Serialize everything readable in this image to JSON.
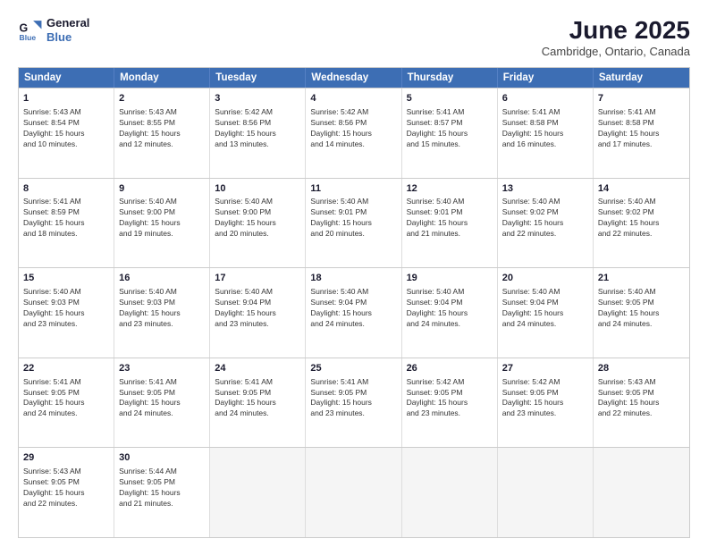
{
  "logo": {
    "line1": "General",
    "line2": "Blue"
  },
  "title": "June 2025",
  "location": "Cambridge, Ontario, Canada",
  "header_days": [
    "Sunday",
    "Monday",
    "Tuesday",
    "Wednesday",
    "Thursday",
    "Friday",
    "Saturday"
  ],
  "rows": [
    [
      {
        "day": "1",
        "lines": [
          "Sunrise: 5:43 AM",
          "Sunset: 8:54 PM",
          "Daylight: 15 hours",
          "and 10 minutes."
        ]
      },
      {
        "day": "2",
        "lines": [
          "Sunrise: 5:43 AM",
          "Sunset: 8:55 PM",
          "Daylight: 15 hours",
          "and 12 minutes."
        ]
      },
      {
        "day": "3",
        "lines": [
          "Sunrise: 5:42 AM",
          "Sunset: 8:56 PM",
          "Daylight: 15 hours",
          "and 13 minutes."
        ]
      },
      {
        "day": "4",
        "lines": [
          "Sunrise: 5:42 AM",
          "Sunset: 8:56 PM",
          "Daylight: 15 hours",
          "and 14 minutes."
        ]
      },
      {
        "day": "5",
        "lines": [
          "Sunrise: 5:41 AM",
          "Sunset: 8:57 PM",
          "Daylight: 15 hours",
          "and 15 minutes."
        ]
      },
      {
        "day": "6",
        "lines": [
          "Sunrise: 5:41 AM",
          "Sunset: 8:58 PM",
          "Daylight: 15 hours",
          "and 16 minutes."
        ]
      },
      {
        "day": "7",
        "lines": [
          "Sunrise: 5:41 AM",
          "Sunset: 8:58 PM",
          "Daylight: 15 hours",
          "and 17 minutes."
        ]
      }
    ],
    [
      {
        "day": "8",
        "lines": [
          "Sunrise: 5:41 AM",
          "Sunset: 8:59 PM",
          "Daylight: 15 hours",
          "and 18 minutes."
        ]
      },
      {
        "day": "9",
        "lines": [
          "Sunrise: 5:40 AM",
          "Sunset: 9:00 PM",
          "Daylight: 15 hours",
          "and 19 minutes."
        ]
      },
      {
        "day": "10",
        "lines": [
          "Sunrise: 5:40 AM",
          "Sunset: 9:00 PM",
          "Daylight: 15 hours",
          "and 20 minutes."
        ]
      },
      {
        "day": "11",
        "lines": [
          "Sunrise: 5:40 AM",
          "Sunset: 9:01 PM",
          "Daylight: 15 hours",
          "and 20 minutes."
        ]
      },
      {
        "day": "12",
        "lines": [
          "Sunrise: 5:40 AM",
          "Sunset: 9:01 PM",
          "Daylight: 15 hours",
          "and 21 minutes."
        ]
      },
      {
        "day": "13",
        "lines": [
          "Sunrise: 5:40 AM",
          "Sunset: 9:02 PM",
          "Daylight: 15 hours",
          "and 22 minutes."
        ]
      },
      {
        "day": "14",
        "lines": [
          "Sunrise: 5:40 AM",
          "Sunset: 9:02 PM",
          "Daylight: 15 hours",
          "and 22 minutes."
        ]
      }
    ],
    [
      {
        "day": "15",
        "lines": [
          "Sunrise: 5:40 AM",
          "Sunset: 9:03 PM",
          "Daylight: 15 hours",
          "and 23 minutes."
        ]
      },
      {
        "day": "16",
        "lines": [
          "Sunrise: 5:40 AM",
          "Sunset: 9:03 PM",
          "Daylight: 15 hours",
          "and 23 minutes."
        ]
      },
      {
        "day": "17",
        "lines": [
          "Sunrise: 5:40 AM",
          "Sunset: 9:04 PM",
          "Daylight: 15 hours",
          "and 23 minutes."
        ]
      },
      {
        "day": "18",
        "lines": [
          "Sunrise: 5:40 AM",
          "Sunset: 9:04 PM",
          "Daylight: 15 hours",
          "and 24 minutes."
        ]
      },
      {
        "day": "19",
        "lines": [
          "Sunrise: 5:40 AM",
          "Sunset: 9:04 PM",
          "Daylight: 15 hours",
          "and 24 minutes."
        ]
      },
      {
        "day": "20",
        "lines": [
          "Sunrise: 5:40 AM",
          "Sunset: 9:04 PM",
          "Daylight: 15 hours",
          "and 24 minutes."
        ]
      },
      {
        "day": "21",
        "lines": [
          "Sunrise: 5:40 AM",
          "Sunset: 9:05 PM",
          "Daylight: 15 hours",
          "and 24 minutes."
        ]
      }
    ],
    [
      {
        "day": "22",
        "lines": [
          "Sunrise: 5:41 AM",
          "Sunset: 9:05 PM",
          "Daylight: 15 hours",
          "and 24 minutes."
        ]
      },
      {
        "day": "23",
        "lines": [
          "Sunrise: 5:41 AM",
          "Sunset: 9:05 PM",
          "Daylight: 15 hours",
          "and 24 minutes."
        ]
      },
      {
        "day": "24",
        "lines": [
          "Sunrise: 5:41 AM",
          "Sunset: 9:05 PM",
          "Daylight: 15 hours",
          "and 24 minutes."
        ]
      },
      {
        "day": "25",
        "lines": [
          "Sunrise: 5:41 AM",
          "Sunset: 9:05 PM",
          "Daylight: 15 hours",
          "and 23 minutes."
        ]
      },
      {
        "day": "26",
        "lines": [
          "Sunrise: 5:42 AM",
          "Sunset: 9:05 PM",
          "Daylight: 15 hours",
          "and 23 minutes."
        ]
      },
      {
        "day": "27",
        "lines": [
          "Sunrise: 5:42 AM",
          "Sunset: 9:05 PM",
          "Daylight: 15 hours",
          "and 23 minutes."
        ]
      },
      {
        "day": "28",
        "lines": [
          "Sunrise: 5:43 AM",
          "Sunset: 9:05 PM",
          "Daylight: 15 hours",
          "and 22 minutes."
        ]
      }
    ],
    [
      {
        "day": "29",
        "lines": [
          "Sunrise: 5:43 AM",
          "Sunset: 9:05 PM",
          "Daylight: 15 hours",
          "and 22 minutes."
        ]
      },
      {
        "day": "30",
        "lines": [
          "Sunrise: 5:44 AM",
          "Sunset: 9:05 PM",
          "Daylight: 15 hours",
          "and 21 minutes."
        ]
      },
      {
        "day": "",
        "lines": []
      },
      {
        "day": "",
        "lines": []
      },
      {
        "day": "",
        "lines": []
      },
      {
        "day": "",
        "lines": []
      },
      {
        "day": "",
        "lines": []
      }
    ]
  ]
}
